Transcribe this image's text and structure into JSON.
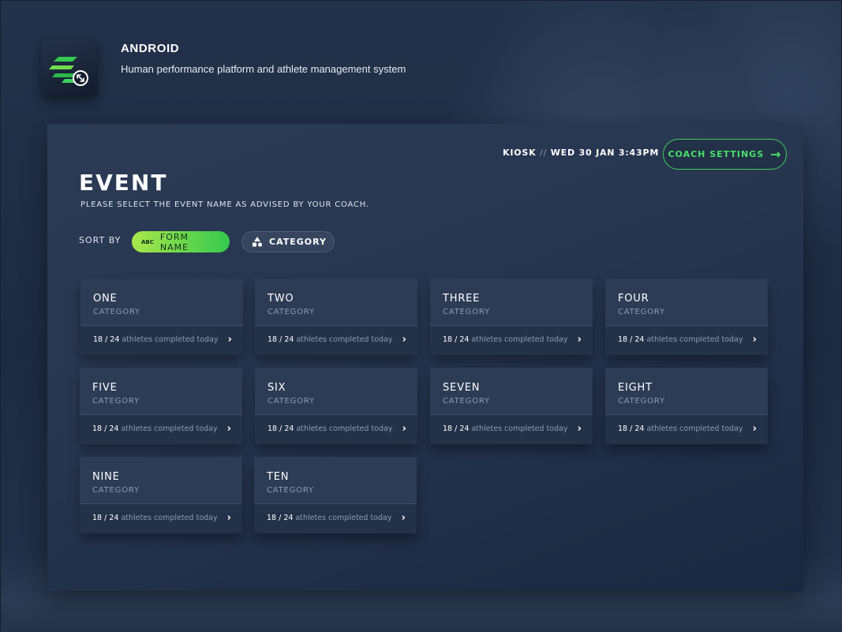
{
  "app": {
    "name": "ANDROID",
    "description": "Human performance platform and athlete management system"
  },
  "header": {
    "kiosk": "KIOSK",
    "separator": "//",
    "datetime": "WED 30 JAN 3:43PM",
    "coach_settings_label": "COACH SETTINGS"
  },
  "page": {
    "title": "EVENT",
    "subtitle": "PLEASE SELECT THE EVENT NAME AS ADVISED BY YOUR COACH."
  },
  "sort": {
    "label": "SORT BY",
    "form_name": {
      "icon_text": "ABC",
      "label": "FORM NAME"
    },
    "category": {
      "label": "CATEGORY"
    }
  },
  "colors": {
    "accent_green": "#46e066",
    "panel": "#2c3b55",
    "card": "#2d3c55"
  },
  "events": [
    {
      "name": "ONE",
      "category": "CATEGORY",
      "completed": "18 / 24",
      "suffix": "athletes completed today"
    },
    {
      "name": "TWO",
      "category": "CATEGORY",
      "completed": "18 / 24",
      "suffix": "athletes completed today"
    },
    {
      "name": "THREE",
      "category": "CATEGORY",
      "completed": "18 / 24",
      "suffix": "athletes completed today"
    },
    {
      "name": "FOUR",
      "category": "CATEGORY",
      "completed": "18 / 24",
      "suffix": "athletes completed today"
    },
    {
      "name": "FIVE",
      "category": "CATEGORY",
      "completed": "18 / 24",
      "suffix": "athletes completed today"
    },
    {
      "name": "SIX",
      "category": "CATEGORY",
      "completed": "18 / 24",
      "suffix": "athletes completed today"
    },
    {
      "name": "SEVEN",
      "category": "CATEGORY",
      "completed": "18 / 24",
      "suffix": "athletes completed today"
    },
    {
      "name": "EIGHT",
      "category": "CATEGORY",
      "completed": "18 / 24",
      "suffix": "athletes completed today"
    },
    {
      "name": "NINE",
      "category": "CATEGORY",
      "completed": "18 / 24",
      "suffix": "athletes completed today"
    },
    {
      "name": "TEN",
      "category": "CATEGORY",
      "completed": "18 / 24",
      "suffix": "athletes completed today"
    }
  ],
  "icons": {
    "logo": "speed-logo-icon",
    "coach_settings": "arrow-right-icon",
    "category_chip": "shapes-icon",
    "card_chevron": "chevron-right-icon"
  }
}
